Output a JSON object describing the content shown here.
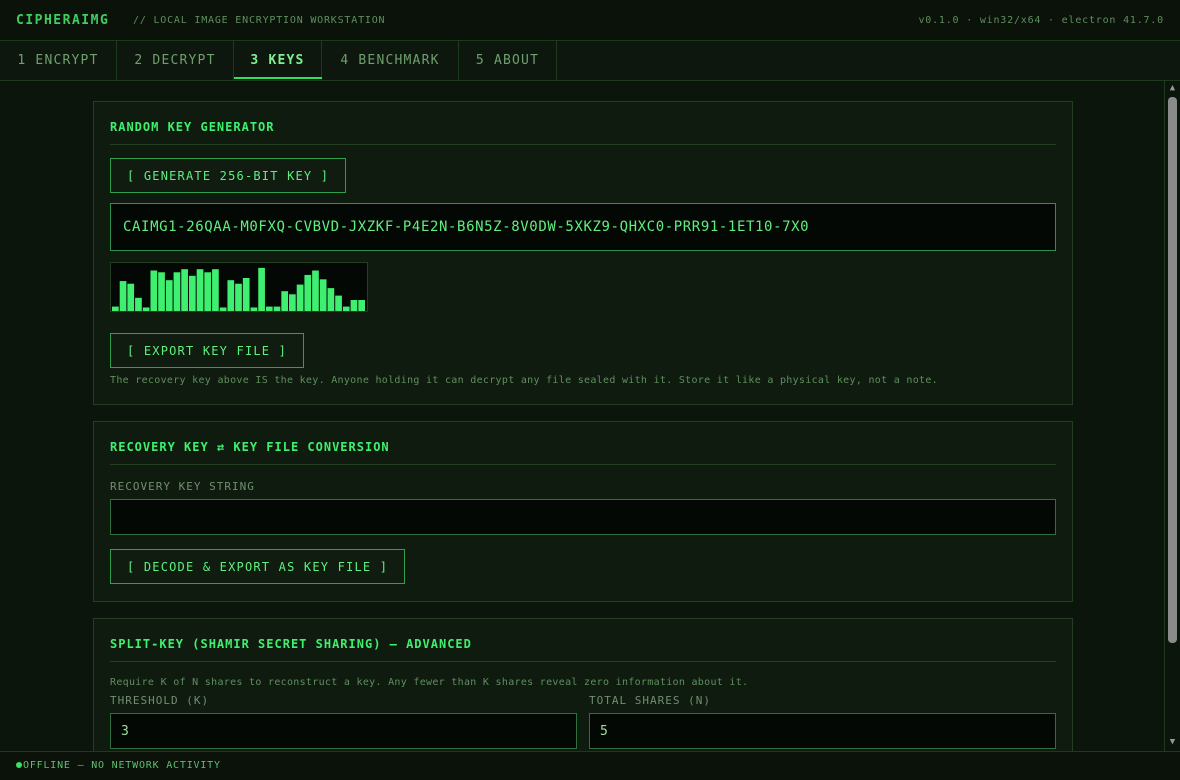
{
  "header": {
    "brand": "CIPHERAIMG",
    "subtitle": "// LOCAL IMAGE ENCRYPTION WORKSTATION",
    "version": "v0.1.0 · win32/x64 · electron 41.7.0"
  },
  "tabs": [
    {
      "label": "1 ENCRYPT"
    },
    {
      "label": "2 DECRYPT"
    },
    {
      "label": "3 KEYS"
    },
    {
      "label": "4 BENCHMARK"
    },
    {
      "label": "5 ABOUT"
    }
  ],
  "active_tab": "3 KEYS",
  "generator": {
    "title": "RANDOM KEY GENERATOR",
    "generate_label": "[ GENERATE 256-BIT KEY ]",
    "key_value": "CAIMG1-26QAA-M0FXQ-CVBVD-JXZKF-P4E2N-B6N5Z-8V0DW-5XKZ9-QHXC0-PRR91-1ET10-7X0",
    "entropy_levels": [
      0.1,
      0.68,
      0.62,
      0.3,
      0.08,
      0.92,
      0.88,
      0.7,
      0.88,
      0.95,
      0.8,
      0.95,
      0.88,
      0.95,
      0.08,
      0.7,
      0.62,
      0.75,
      0.08,
      0.98,
      0.1,
      0.1,
      0.45,
      0.38,
      0.6,
      0.82,
      0.92,
      0.72,
      0.52,
      0.35,
      0.1,
      0.25,
      0.25
    ],
    "export_label": "[ EXPORT KEY FILE ]",
    "note": "The recovery key above IS the key. Anyone holding it can decrypt any file sealed with it. Store it like a physical key, not a note."
  },
  "conversion": {
    "title": "RECOVERY KEY ⇄ KEY FILE CONVERSION",
    "field_label": "RECOVERY KEY STRING",
    "field_value": "",
    "button_label": "[ DECODE & EXPORT AS KEY FILE ]"
  },
  "shamir": {
    "title": "SPLIT-KEY (SHAMIR SECRET SHARING) — ADVANCED",
    "description": "Require K of N shares to reconstruct a key. Any fewer than K shares reveal zero information about it.",
    "threshold_label": "THRESHOLD (K)",
    "threshold_value": "3",
    "total_label": "TOTAL SHARES (N)",
    "total_value": "5"
  },
  "status": {
    "text": "OFFLINE — NO NETWORK ACTIVITY"
  },
  "colors": {
    "accent": "#3fef6f",
    "background": "#0c150c",
    "panel": "#101b10",
    "bar": "#3fef6f"
  }
}
